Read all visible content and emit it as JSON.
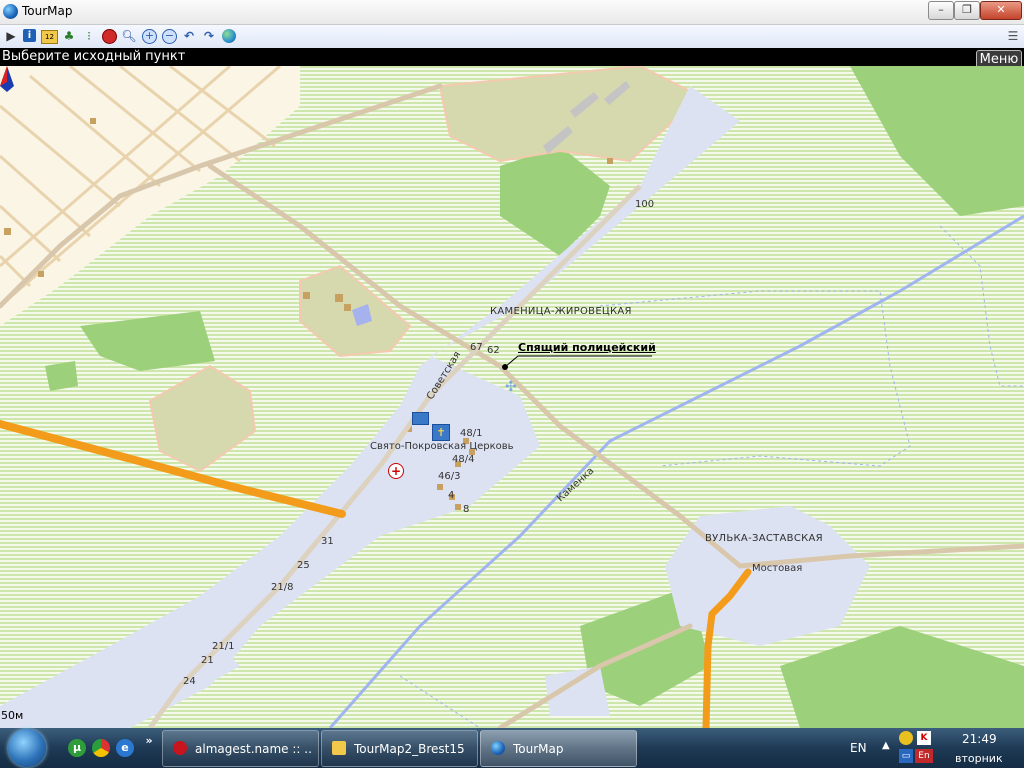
{
  "window": {
    "title": "TourMap",
    "min_label": "–",
    "max_label": "❐",
    "close_label": "✕"
  },
  "toolbar": {
    "icons": [
      "play-icon",
      "info-icon",
      "coordinates-icon",
      "tree-icon",
      "traffic-light-icon",
      "stop-icon",
      "search-icon",
      "zoom-in-icon",
      "zoom-out-icon",
      "undo-icon",
      "redo-icon",
      "globe-icon",
      "list-icon"
    ]
  },
  "status": {
    "text": "Выберите исходный пункт"
  },
  "menu": {
    "label": "Меню"
  },
  "map": {
    "places": {
      "kamenitsa": "КАМЕНИЦА-ЖИРОВЕЦКАЯ",
      "vulka": "ВУЛЬКА-ЗАСТАВСКАЯ"
    },
    "streets": {
      "sovetskaya": "Советская",
      "kamenka": "Каменка",
      "mostovaya": "Мостовая"
    },
    "poi": {
      "police": "Спящий полицейский",
      "church": "Свято-Покровская Церковь"
    },
    "house_numbers": {
      "n100": "100",
      "n67": "67",
      "n62": "62",
      "n48_1": "48/1",
      "n48_4": "48/4",
      "n46_3": "46/3",
      "n4": "4",
      "n8": "8",
      "n31": "31",
      "n25": "25",
      "n21_8": "21/8",
      "n21_1": "21/1",
      "n21": "21",
      "n24": "24"
    },
    "scale": "50м",
    "colors": {
      "forest_stripe": "#c8e3a3",
      "village": "#dfe3f4",
      "main_road": "#f39c1b",
      "road": "#d9c7ac",
      "river": "#9fb4f0"
    }
  },
  "taskbar": {
    "tasks": [
      {
        "label": "almagest.name :: ...",
        "icon": "opera-icon"
      },
      {
        "label": "TourMap2_Brest15",
        "icon": "folder-icon"
      },
      {
        "label": "TourMap",
        "icon": "tourmap-icon"
      }
    ],
    "quick_launch_more": "»",
    "lang": "EN",
    "tray_arrow": "▲",
    "tray_lang": "En",
    "clock_time": "21:49",
    "clock_day": "вторник"
  }
}
